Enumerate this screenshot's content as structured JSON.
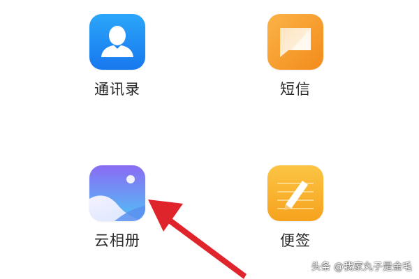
{
  "apps": [
    {
      "label": "通讯录",
      "icon": "contacts-icon",
      "color": "#1E90F5"
    },
    {
      "label": "短信",
      "icon": "messages-icon",
      "color": "#F7A12C"
    },
    {
      "label": "云相册",
      "icon": "gallery-icon",
      "color": "#7C6CF2"
    },
    {
      "label": "便签",
      "icon": "notes-icon",
      "color": "#F9B52A"
    }
  ],
  "annotation": {
    "arrow_color": "#E0242B",
    "icon": "pointer-arrow"
  },
  "watermark": "头条 @我家丸子是金毛"
}
